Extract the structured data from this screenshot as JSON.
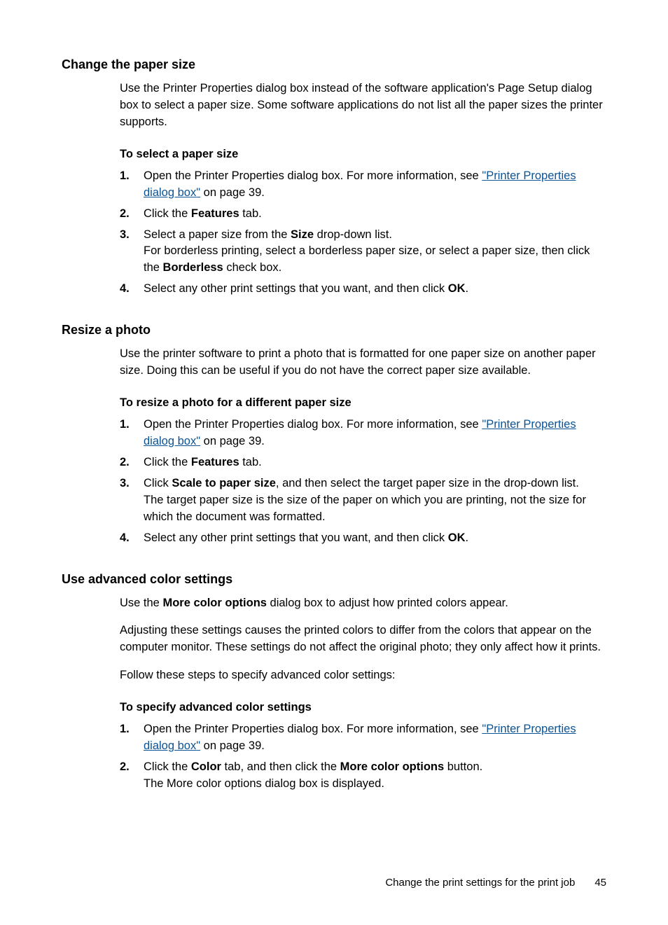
{
  "section1": {
    "heading": "Change the paper size",
    "intro": "Use the Printer Properties dialog box instead of the software application's Page Setup dialog box to select a paper size. Some software applications do not list all the paper sizes the printer supports.",
    "subheading": "To select a paper size",
    "steps": {
      "s1_prefix": "Open the Printer Properties dialog box. For more information, see ",
      "s1_quote_open": "\"",
      "s1_link": "Printer Properties dialog box",
      "s1_quote_close": "\"",
      "s1_suffix": " on page 39.",
      "s2_a": "Click the ",
      "s2_b": "Features",
      "s2_c": " tab.",
      "s3_a": "Select a paper size from the ",
      "s3_b": "Size",
      "s3_c": " drop-down list.",
      "s3_d": "For borderless printing, select a borderless paper size, or select a paper size, then click the ",
      "s3_e": "Borderless",
      "s3_f": " check box.",
      "s4_a": "Select any other print settings that you want, and then click ",
      "s4_b": "OK",
      "s4_c": "."
    }
  },
  "section2": {
    "heading": "Resize a photo",
    "intro": "Use the printer software to print a photo that is formatted for one paper size on another paper size. Doing this can be useful if you do not have the correct paper size available.",
    "subheading": "To resize a photo for a different paper size",
    "steps": {
      "s1_prefix": "Open the Printer Properties dialog box. For more information, see ",
      "s1_quote_open": "\"",
      "s1_link": "Printer Properties dialog box",
      "s1_quote_close": "\"",
      "s1_suffix": " on page 39.",
      "s2_a": "Click the ",
      "s2_b": "Features",
      "s2_c": " tab.",
      "s3_a": "Click ",
      "s3_b": "Scale to paper size",
      "s3_c": ", and then select the target paper size in the drop-down list.",
      "s3_d": "The target paper size is the size of the paper on which you are printing, not the size for which the document was formatted.",
      "s4_a": "Select any other print settings that you want, and then click ",
      "s4_b": "OK",
      "s4_c": "."
    }
  },
  "section3": {
    "heading": "Use advanced color settings",
    "intro_a": "Use the ",
    "intro_b": "More color options",
    "intro_c": " dialog box to adjust how printed colors appear.",
    "para2": "Adjusting these settings causes the printed colors to differ from the colors that appear on the computer monitor. These settings do not affect the original photo; they only affect how it prints.",
    "para3": "Follow these steps to specify advanced color settings:",
    "subheading": "To specify advanced color settings",
    "steps": {
      "s1_prefix": "Open the Printer Properties dialog box. For more information, see ",
      "s1_quote_open": "\"",
      "s1_link": "Printer Properties dialog box",
      "s1_quote_close": "\"",
      "s1_suffix": " on page 39.",
      "s2_a": "Click the ",
      "s2_b": "Color",
      "s2_c": " tab, and then click the ",
      "s2_d": "More color options",
      "s2_e": " button.",
      "s2_f": "The More color options dialog box is displayed."
    }
  },
  "footer": {
    "text": "Change the print settings for the print job",
    "page": "45"
  },
  "numbers": {
    "n1": "1.",
    "n2": "2.",
    "n3": "3.",
    "n4": "4."
  }
}
